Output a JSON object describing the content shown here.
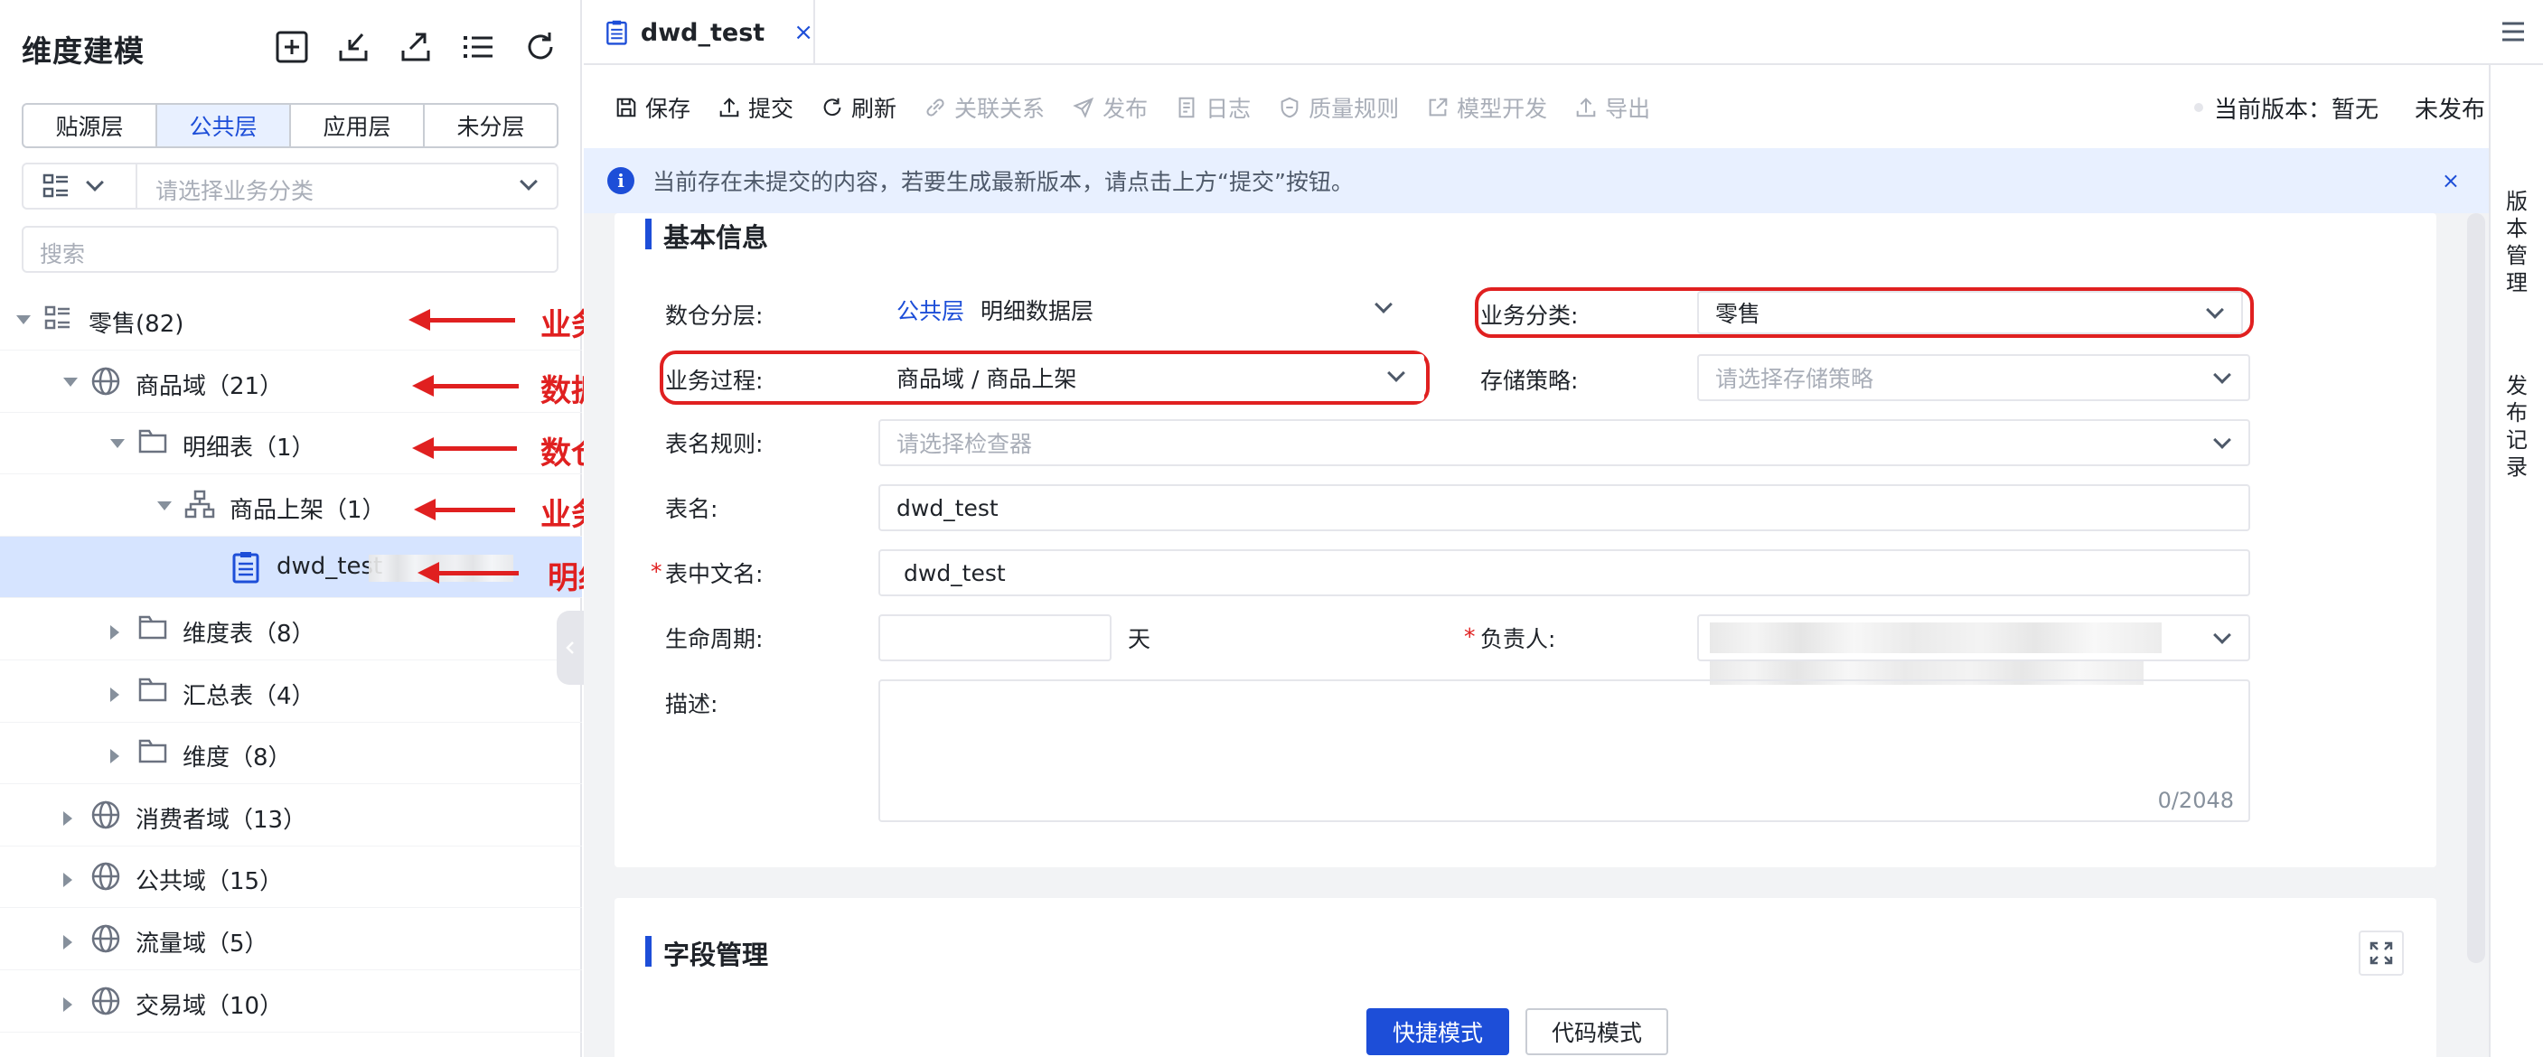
{
  "sidebar": {
    "title": "维度建模",
    "layers": [
      "贴源层",
      "公共层",
      "应用层",
      "未分层"
    ],
    "active_layer": "公共层",
    "category_placeholder": "请选择业务分类",
    "search_placeholder": "搜索",
    "tree": [
      {
        "label": "零售",
        "count": "(82)",
        "icon": "category-icon",
        "expanded": true
      },
      {
        "label": "商品域",
        "count": "（21）",
        "icon": "globe-icon",
        "expanded": true
      },
      {
        "label": "明细表",
        "count": "（1）",
        "icon": "folder-icon",
        "expanded": true
      },
      {
        "label": "商品上架",
        "count": "（1）",
        "icon": "process-icon",
        "expanded": true
      },
      {
        "label": "dwd_test",
        "count": "",
        "icon": "table-icon",
        "selected": true
      },
      {
        "label": "维度表",
        "count": "（8）",
        "icon": "folder-icon",
        "expanded": false
      },
      {
        "label": "汇总表",
        "count": "（4）",
        "icon": "folder-icon",
        "expanded": false
      },
      {
        "label": "维度",
        "count": "（8）",
        "icon": "folder-icon",
        "expanded": false
      },
      {
        "label": "消费者域",
        "count": "（13）",
        "icon": "globe-icon",
        "expanded": false
      },
      {
        "label": "公共域",
        "count": "（15）",
        "icon": "globe-icon",
        "expanded": false
      },
      {
        "label": "流量域",
        "count": "（5）",
        "icon": "globe-icon",
        "expanded": false
      },
      {
        "label": "交易域",
        "count": "（10）",
        "icon": "globe-icon",
        "expanded": false
      }
    ]
  },
  "annotations": [
    "业务分类",
    "数据域",
    "数仓分层",
    "业务过程",
    "明细表"
  ],
  "tab": {
    "title": "dwd_test",
    "close": "×"
  },
  "toolbar": {
    "items": [
      {
        "label": "保存",
        "icon": "save-icon",
        "enabled": true
      },
      {
        "label": "提交",
        "icon": "upload-icon",
        "enabled": true
      },
      {
        "label": "刷新",
        "icon": "refresh-icon",
        "enabled": true
      },
      {
        "label": "关联关系",
        "icon": "link-icon",
        "enabled": false
      },
      {
        "label": "发布",
        "icon": "send-icon",
        "enabled": false
      },
      {
        "label": "日志",
        "icon": "log-icon",
        "enabled": false
      },
      {
        "label": "质量规则",
        "icon": "shield-icon",
        "enabled": false
      },
      {
        "label": "模型开发",
        "icon": "external-icon",
        "enabled": false
      },
      {
        "label": "导出",
        "icon": "export-icon",
        "enabled": false
      }
    ],
    "version_label": "当前版本：暂无",
    "publish_status": "未发布"
  },
  "notice": {
    "text": "当前存在未提交的内容，若要生成最新版本，请点击上方“提交”按钮。",
    "close": "×"
  },
  "basic_info": {
    "title": "基本信息",
    "layer_label": "数仓分层:",
    "layer_tag": "公共层",
    "layer_value": "明细数据层",
    "category_label": "业务分类:",
    "category_value": "零售",
    "process_label": "业务过程:",
    "process_value": "商品域 / 商品上架",
    "storage_label": "存储策略:",
    "storage_placeholder": "请选择存储策略",
    "rule_label": "表名规则:",
    "rule_placeholder": "请选择检查器",
    "name_label": "表名:",
    "name_value": "dwd_test",
    "cn_name_label": "表中文名:",
    "cn_name_value": "dwd_test",
    "lifecycle_label": "生命周期:",
    "lifecycle_value": "",
    "lifecycle_unit": "天",
    "owner_label": "负责人:",
    "desc_label": "描述:",
    "desc_counter": "0/2048",
    "required_mark": "*"
  },
  "field_mgmt": {
    "title": "字段管理",
    "quick_mode": "快捷模式",
    "code_mode": "代码模式"
  },
  "right_panel": {
    "version_mgmt": "版本管理",
    "publish_record": "发布记录"
  },
  "colors": {
    "primary": "#1d4ed8",
    "annotation": "#e02020",
    "selected_row": "#d6e4ff",
    "notice_bg": "#e8f0ff"
  }
}
